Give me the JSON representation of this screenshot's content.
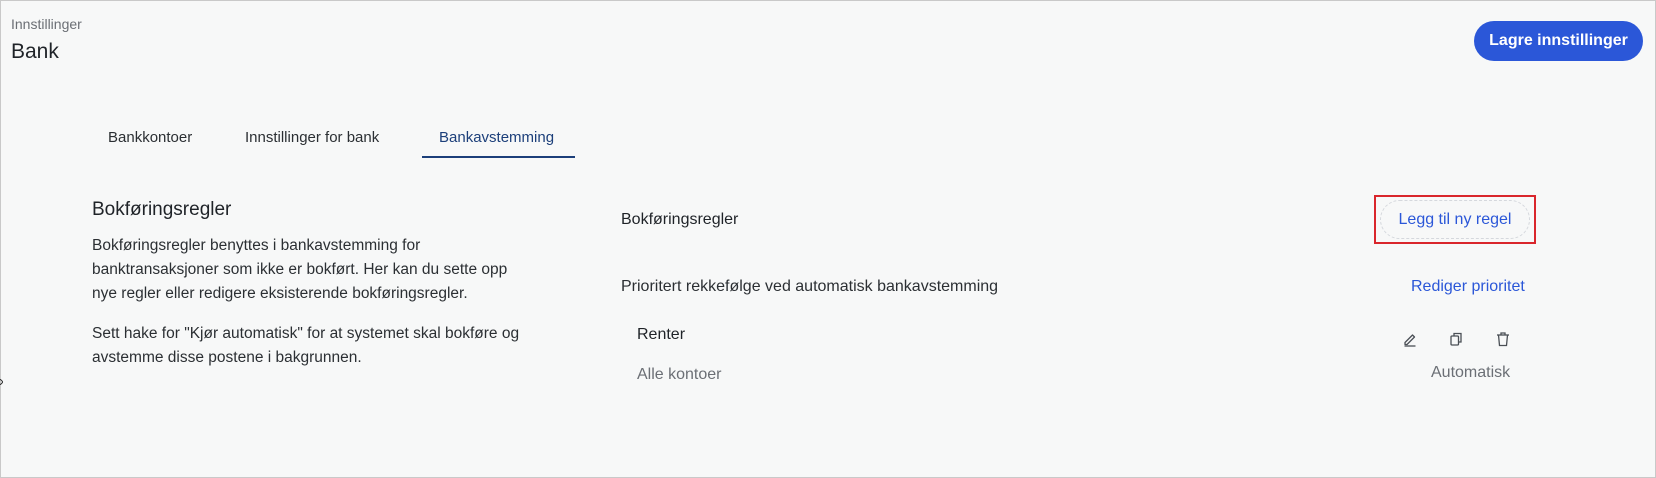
{
  "header": {
    "breadcrumb": "Innstillinger",
    "title": "Bank",
    "save_label": "Lagre innstillinger"
  },
  "tabs": [
    {
      "label": "Bankkontoer",
      "active": false
    },
    {
      "label": "Innstillinger for bank",
      "active": false
    },
    {
      "label": "Bankavstemming",
      "active": true
    }
  ],
  "left": {
    "title": "Bokføringsregler",
    "paragraph1": "Bokføringsregler benyttes i bankavstemming for banktransaksjoner som ikke er bokført. Her kan du sette opp nye regler eller redigere eksisterende bokføringsregler.",
    "paragraph2": "Sett hake for \"Kjør automatisk\" for at systemet skal bokføre og avstemme disse postene i bakgrunnen."
  },
  "right": {
    "title": "Bokføringsregler",
    "add_rule_label": "Legg til ny regel",
    "priority_label": "Prioritert rekkefølge ved automatisk bankavstemming",
    "priority_link": "Rediger prioritet",
    "rules": [
      {
        "name": "Renter",
        "accounts": "Alle kontoer",
        "mode": "Automatisk"
      }
    ]
  },
  "icons": {
    "edit": "pencil-icon",
    "copy": "copy-icon",
    "delete": "trash-icon"
  },
  "colors": {
    "primary": "#2b57d8",
    "active_tab": "#1c3f7a",
    "highlight_border": "#d9262c",
    "background": "#f7f8f8"
  }
}
